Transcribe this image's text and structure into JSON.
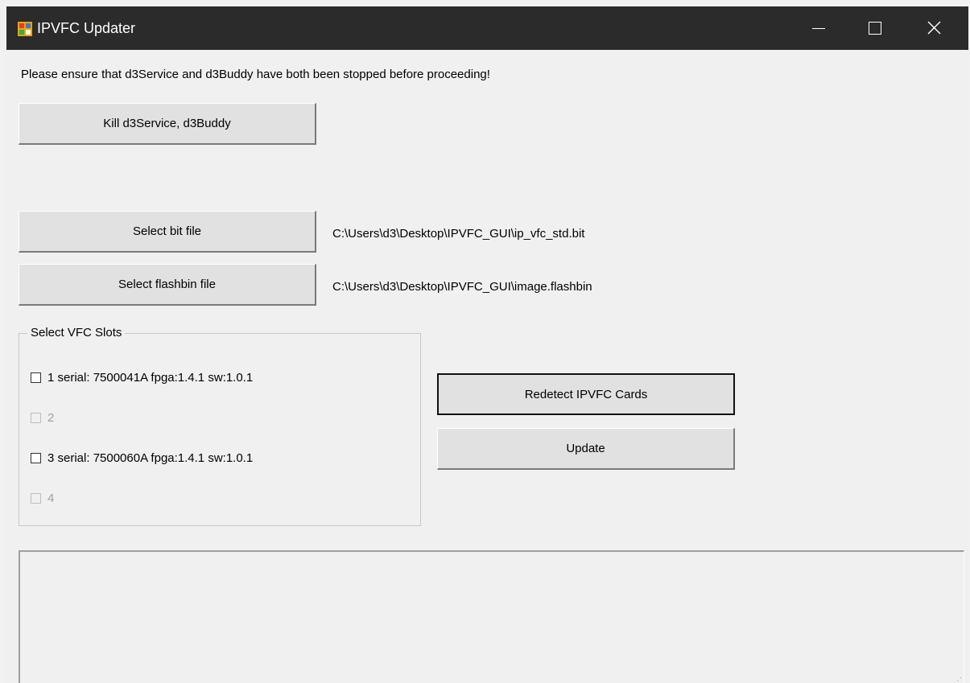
{
  "window": {
    "title": "IPVFC Updater",
    "controls": [
      "minimize",
      "maximize",
      "close"
    ]
  },
  "warning_text": "Please ensure that d3Service and d3Buddy have both been stopped before proceeding!",
  "buttons": {
    "kill": "Kill d3Service, d3Buddy",
    "select_bit": "Select bit file",
    "select_flashbin": "Select flashbin file",
    "redetect": "Redetect IPVFC Cards",
    "update": "Update"
  },
  "paths": {
    "bit_file": "C:\\Users\\d3\\Desktop\\IPVFC_GUI\\ip_vfc_std.bit",
    "flashbin_file": "C:\\Users\\d3\\Desktop\\IPVFC_GUI\\image.flashbin"
  },
  "slots_group": {
    "legend": "Select VFC Slots",
    "slots": [
      {
        "label": "1 serial: 7500041A fpga:1.4.1 sw:1.0.1",
        "checked": false,
        "enabled": true
      },
      {
        "label": "2",
        "checked": false,
        "enabled": false
      },
      {
        "label": "3 serial: 7500060A fpga:1.4.1 sw:1.0.1",
        "checked": false,
        "enabled": true
      },
      {
        "label": "4",
        "checked": false,
        "enabled": false
      }
    ]
  },
  "log": {
    "text": ""
  },
  "colors": {
    "titlebar": "#2b2b2b",
    "window_bg": "#f0f0f0",
    "button_bg": "#e1e1e1"
  }
}
